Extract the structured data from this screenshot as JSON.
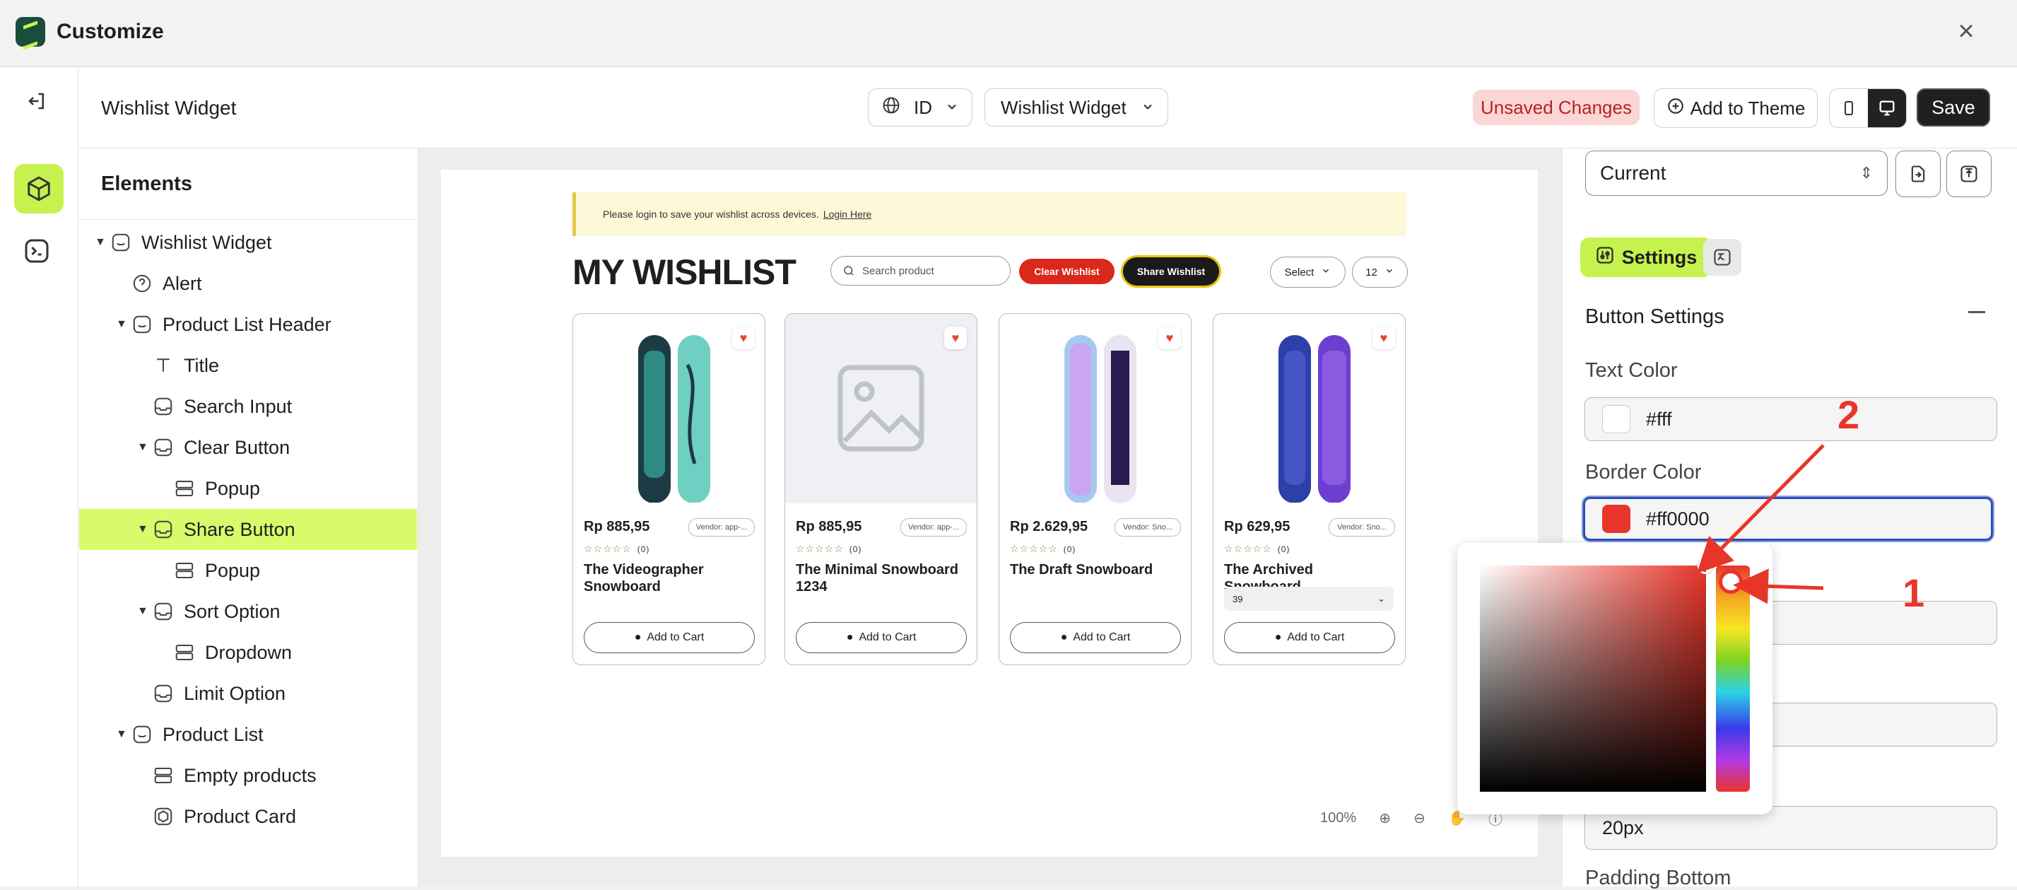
{
  "window": {
    "title": "Customize"
  },
  "header": {
    "page_title": "Wishlist Widget",
    "language": "ID",
    "widget_select": "Wishlist Widget",
    "unsaved_label": "Unsaved Changes",
    "add_to_theme_label": "Add to Theme",
    "save_label": "Save"
  },
  "elements_panel": {
    "heading": "Elements",
    "items": [
      {
        "label": "Wishlist Widget",
        "icon": "widget-icon"
      },
      {
        "label": "Alert",
        "icon": "question-circle-icon"
      },
      {
        "label": "Product List Header",
        "icon": "widget-icon"
      },
      {
        "label": "Title",
        "icon": "text-icon"
      },
      {
        "label": "Search Input",
        "icon": "input-icon"
      },
      {
        "label": "Clear Button",
        "icon": "input-icon"
      },
      {
        "label": "Popup",
        "icon": "layout-icon"
      },
      {
        "label": "Share Button",
        "icon": "input-icon"
      },
      {
        "label": "Popup",
        "icon": "layout-icon"
      },
      {
        "label": "Sort Option",
        "icon": "input-icon"
      },
      {
        "label": "Dropdown",
        "icon": "layout-icon"
      },
      {
        "label": "Limit Option",
        "icon": "input-icon"
      },
      {
        "label": "Product List",
        "icon": "widget-icon"
      },
      {
        "label": "Empty products",
        "icon": "layout-icon"
      },
      {
        "label": "Product Card",
        "icon": "card-icon"
      }
    ]
  },
  "preview": {
    "alert_text": "Please login to save your wishlist across devices.",
    "alert_link": "Login Here",
    "title": "MY WISHLIST",
    "search_placeholder": "Search product",
    "clear_label": "Clear Wishlist",
    "share_label": "Share Wishlist",
    "sort_label": "Select",
    "limit_label": "12",
    "add_to_cart": "Add to Cart",
    "products": [
      {
        "price": "Rp 885,95",
        "vendor": "Vendor: app-...",
        "reviews": "(0)",
        "name": "The Videographer Snowboard",
        "variant": ""
      },
      {
        "price": "Rp 885,95",
        "vendor": "Vendor: app-...",
        "reviews": "(0)",
        "name": "The Minimal Snowboard 1234",
        "variant": ""
      },
      {
        "price": "Rp 2.629,95",
        "vendor": "Vendor: Sno...",
        "reviews": "(0)",
        "name": "The Draft Snowboard",
        "variant": ""
      },
      {
        "price": "Rp 629,95",
        "vendor": "Vendor: Sno...",
        "reviews": "(0)",
        "name": "The Archived Snowboard",
        "variant": "39"
      }
    ],
    "zoom": "100%"
  },
  "settings_panel": {
    "version": "Current",
    "settings_tab": "Settings",
    "section_title": "Button Settings",
    "text_color_label": "Text Color",
    "text_color_value": "#fff",
    "border_color_label": "Border Color",
    "border_color_value": "#ff0000",
    "padding_value": "20px",
    "next_label": "Padding Bottom"
  },
  "annotations": {
    "one": "1",
    "two": "2"
  },
  "colors": {
    "accent": "#c6f24e",
    "danger": "#e8352a",
    "focus": "#2b50b8"
  }
}
